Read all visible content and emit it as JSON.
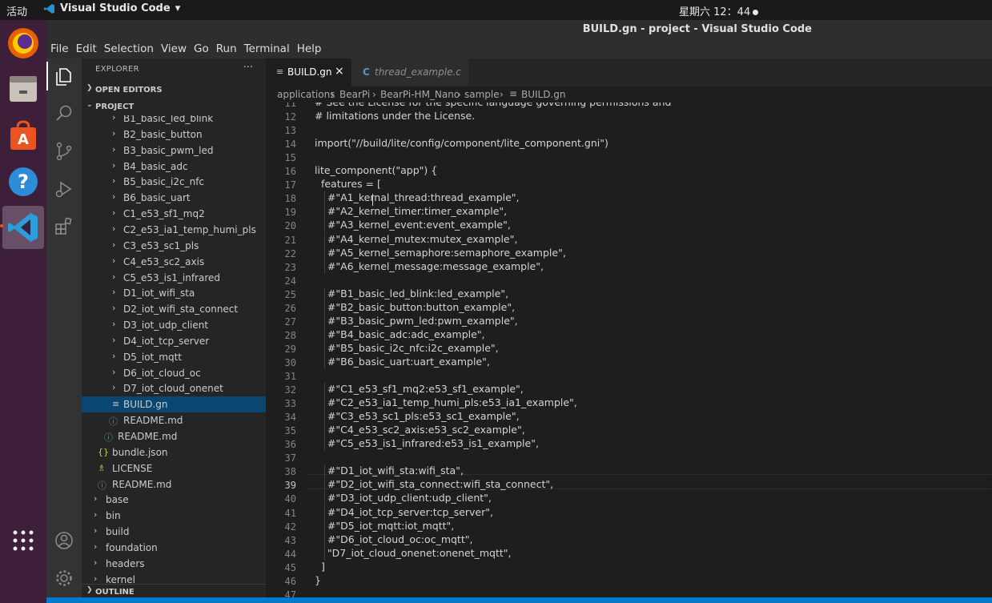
{
  "topbar": {
    "activities": "活动",
    "app_name": "Visual Studio Code",
    "clock": "星期六 12：44"
  },
  "window": {
    "title": "BUILD.gn - project - Visual Studio Code"
  },
  "menu": [
    "File",
    "Edit",
    "Selection",
    "View",
    "Go",
    "Run",
    "Terminal",
    "Help"
  ],
  "sidebar": {
    "title": "EXPLORER",
    "more": "···",
    "open_editors": "OPEN EDITORS",
    "project": "PROJECT",
    "outline": "OUTLINE",
    "tree": [
      {
        "label": "B1_basic_led_blink",
        "kind": "folder"
      },
      {
        "label": "B2_basic_button",
        "kind": "folder"
      },
      {
        "label": "B3_basic_pwm_led",
        "kind": "folder"
      },
      {
        "label": "B4_basic_adc",
        "kind": "folder"
      },
      {
        "label": "B5_basic_i2c_nfc",
        "kind": "folder"
      },
      {
        "label": "B6_basic_uart",
        "kind": "folder"
      },
      {
        "label": "C1_e53_sf1_mq2",
        "kind": "folder"
      },
      {
        "label": "C2_e53_ia1_temp_humi_pls",
        "kind": "folder"
      },
      {
        "label": "C3_e53_sc1_pls",
        "kind": "folder"
      },
      {
        "label": "C4_e53_sc2_axis",
        "kind": "folder"
      },
      {
        "label": "C5_e53_is1_infrared",
        "kind": "folder"
      },
      {
        "label": "D1_iot_wifi_sta",
        "kind": "folder"
      },
      {
        "label": "D2_iot_wifi_sta_connect",
        "kind": "folder"
      },
      {
        "label": "D3_iot_udp_client",
        "kind": "folder"
      },
      {
        "label": "D4_iot_tcp_server",
        "kind": "folder"
      },
      {
        "label": "D5_iot_mqtt",
        "kind": "folder"
      },
      {
        "label": "D6_iot_cloud_oc",
        "kind": "folder"
      },
      {
        "label": "D7_iot_cloud_onenet",
        "kind": "folder"
      },
      {
        "label": "BUILD.gn",
        "kind": "gn",
        "selected": true
      },
      {
        "label": "README.md",
        "kind": "md"
      },
      {
        "label": "README.md",
        "kind": "md"
      },
      {
        "label": "bundle.json",
        "kind": "json"
      },
      {
        "label": "LICENSE",
        "kind": "license"
      },
      {
        "label": "README.md",
        "kind": "md"
      },
      {
        "label": "base",
        "kind": "folder"
      },
      {
        "label": "bin",
        "kind": "folder"
      },
      {
        "label": "build",
        "kind": "folder"
      },
      {
        "label": "foundation",
        "kind": "folder"
      },
      {
        "label": "headers",
        "kind": "folder"
      },
      {
        "label": "kernel",
        "kind": "folder"
      }
    ]
  },
  "tabs": [
    {
      "label": "BUILD.gn",
      "active": true,
      "close": "×"
    },
    {
      "label": "thread_example.c",
      "active": false,
      "icon": "C"
    }
  ],
  "breadcrumb": [
    "applications",
    "BearPi",
    "BearPi-HM_Nano",
    "sample",
    "BUILD.gn"
  ],
  "editor": {
    "current_line": "39",
    "lines": [
      {
        "n": "11",
        "text": "# See the License for the specific language governing permissions and"
      },
      {
        "n": "12",
        "text": "# limitations under the License."
      },
      {
        "n": "13",
        "text": ""
      },
      {
        "n": "14",
        "text": "import(\"//build/lite/config/component/lite_component.gni\")"
      },
      {
        "n": "15",
        "text": ""
      },
      {
        "n": "16",
        "text": "lite_component(\"app\") {"
      },
      {
        "n": "17",
        "text": "  features = ["
      },
      {
        "n": "18",
        "text": "    #\"A1_kernal_thread:thread_example\","
      },
      {
        "n": "19",
        "text": "    #\"A2_kernel_timer:timer_example\","
      },
      {
        "n": "20",
        "text": "    #\"A3_kernel_event:event_example\","
      },
      {
        "n": "21",
        "text": "    #\"A4_kernel_mutex:mutex_example\","
      },
      {
        "n": "22",
        "text": "    #\"A5_kernel_semaphore:semaphore_example\","
      },
      {
        "n": "23",
        "text": "    #\"A6_kernel_message:message_example\","
      },
      {
        "n": "24",
        "text": ""
      },
      {
        "n": "25",
        "text": "    #\"B1_basic_led_blink:led_example\","
      },
      {
        "n": "26",
        "text": "    #\"B2_basic_button:button_example\","
      },
      {
        "n": "27",
        "text": "    #\"B3_basic_pwm_led:pwm_example\","
      },
      {
        "n": "28",
        "text": "    #\"B4_basic_adc:adc_example\","
      },
      {
        "n": "29",
        "text": "    #\"B5_basic_i2c_nfc:i2c_example\","
      },
      {
        "n": "30",
        "text": "    #\"B6_basic_uart:uart_example\","
      },
      {
        "n": "31",
        "text": ""
      },
      {
        "n": "32",
        "text": "    #\"C1_e53_sf1_mq2:e53_sf1_example\","
      },
      {
        "n": "33",
        "text": "    #\"C2_e53_ia1_temp_humi_pls:e53_ia1_example\","
      },
      {
        "n": "34",
        "text": "    #\"C3_e53_sc1_pls:e53_sc1_example\","
      },
      {
        "n": "35",
        "text": "    #\"C4_e53_sc2_axis:e53_sc2_example\","
      },
      {
        "n": "36",
        "text": "    #\"C5_e53_is1_infrared:e53_is1_example\","
      },
      {
        "n": "37",
        "text": ""
      },
      {
        "n": "38",
        "text": "    #\"D1_iot_wifi_sta:wifi_sta\","
      },
      {
        "n": "39",
        "text": "    #\"D2_iot_wifi_sta_connect:wifi_sta_connect\","
      },
      {
        "n": "40",
        "text": "    #\"D3_iot_udp_client:udp_client\","
      },
      {
        "n": "41",
        "text": "    #\"D4_iot_tcp_server:tcp_server\","
      },
      {
        "n": "42",
        "text": "    #\"D5_iot_mqtt:iot_mqtt\","
      },
      {
        "n": "43",
        "text": "    #\"D6_iot_cloud_oc:oc_mqtt\","
      },
      {
        "n": "44",
        "text": "    \"D7_iot_cloud_onenet:onenet_mqtt\","
      },
      {
        "n": "45",
        "text": "  ]"
      },
      {
        "n": "46",
        "text": "}"
      },
      {
        "n": "47",
        "text": ""
      }
    ]
  },
  "colors": {
    "accent": "#007acc",
    "selection": "#094771",
    "dock": "#3d1f3a",
    "ubuntu_orange": "#e95420"
  }
}
